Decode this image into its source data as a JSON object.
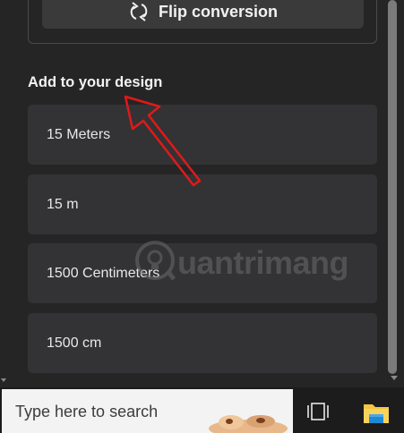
{
  "flip": {
    "label": "Flip conversion",
    "icon": "flip-arrows-icon"
  },
  "section": {
    "title": "Add to your design"
  },
  "options": [
    {
      "label": "15 Meters"
    },
    {
      "label": "15 m"
    },
    {
      "label": "1500 Centimeters"
    },
    {
      "label": "1500 cm"
    }
  ],
  "watermark": {
    "text": "uantrimang"
  },
  "taskbar": {
    "search_placeholder": "Type here to search",
    "task_view_icon": "task-view-icon",
    "explorer_icon": "file-explorer-icon"
  },
  "colors": {
    "panel_bg": "#252526",
    "card_bg": "#333335",
    "button_bg": "#3a3a3b",
    "arrow_red": "#e11919",
    "explorer_yellow": "#f5c542",
    "explorer_blue": "#1e8ad6"
  }
}
